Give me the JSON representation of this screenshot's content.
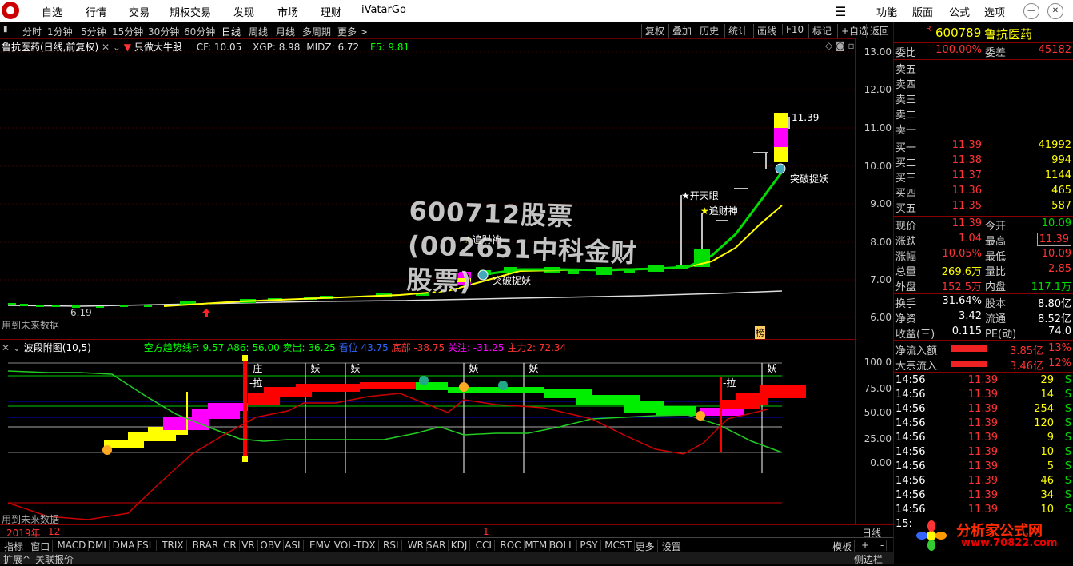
{
  "menu": {
    "items": [
      "自选",
      "行情",
      "交易",
      "期权交易",
      "发现",
      "市场",
      "理财",
      "iVatarGo"
    ],
    "right": [
      "功能",
      "版面",
      "公式",
      "选项"
    ]
  },
  "toolbar": {
    "periods": [
      "分时",
      "1分钟",
      "5分钟",
      "15分钟",
      "30分钟",
      "60分钟",
      "日线",
      "周线",
      "月线",
      "多周期",
      "更多 >"
    ],
    "active": "日线",
    "right": [
      "复权",
      "叠加",
      "历史",
      "统计",
      "画线",
      "F10",
      "标记",
      "+自选",
      "返回"
    ]
  },
  "main": {
    "title": "鲁抗医药(日线,前复权)",
    "indicator_name": "只做大牛股",
    "cf": "CF: 10.05",
    "xgp": "XGP: 8.98",
    "midz": "MIDZ: 6.72",
    "f5": "F5: 9.81",
    "yticks": [
      "13.00",
      "12.00",
      "11.00",
      "10.00",
      "9.00",
      "8.00",
      "7.00",
      "6.00"
    ],
    "annotations": {
      "high": "11.39",
      "low": "6.19",
      "tp1": "突破捉妖",
      "tp2": "突破捉妖",
      "zcs1": "追财神",
      "zcs2": "追财神",
      "ktg": "开天眼",
      "bang": "榜"
    },
    "note": "用到未来数据"
  },
  "sub": {
    "title": "波段附图(10,5)",
    "line": "空方趋势线F: 9.57  A86: 56.00  卖出: 36.25",
    "hold": "看位",
    "hold_val": "43.75",
    "bottom": "底部 -38.75",
    "focus": "关注: -31.25",
    "main": "主力2: 72.34",
    "yticks": [
      "100.0",
      "75.00",
      "50.00",
      "25.00",
      "0.00"
    ],
    "labels": {
      "zhuang": "庄",
      "la1": "拉",
      "la2": "拉",
      "yao": "妖"
    },
    "note": "用到未来数据"
  },
  "timeline": {
    "year": "2019年",
    "month": "12",
    "mark": "1",
    "period": "日线"
  },
  "bottom_tabs": [
    "指标",
    "窗口",
    "MACD",
    "DMI",
    "DMA",
    "FSL",
    "TRIX",
    "BRAR",
    "CR",
    "VR",
    "OBV",
    "ASI",
    "EMV",
    "VOL-TDX",
    "RSI",
    "WR",
    "SAR",
    "KDJ",
    "CCI",
    "ROC",
    "MTM",
    "BOLL",
    "PSY",
    "MCST",
    "更多",
    "设置"
  ],
  "bottom_right": "模板",
  "status": {
    "expand": "扩展^",
    "linked": "关联报价",
    "side": "侧边栏"
  },
  "quote": {
    "badge": "R",
    "code": "600789",
    "name": "鲁抗医药",
    "weibi_label": "委比",
    "weibi": "100.00%",
    "weicha_label": "委差",
    "weicha": "45182",
    "sells": [
      {
        "l": "卖五"
      },
      {
        "l": "卖四"
      },
      {
        "l": "卖三"
      },
      {
        "l": "卖二"
      },
      {
        "l": "卖一"
      }
    ],
    "buys": [
      {
        "l": "买一",
        "p": "11.39",
        "v": "41992"
      },
      {
        "l": "买二",
        "p": "11.38",
        "v": "994"
      },
      {
        "l": "买三",
        "p": "11.37",
        "v": "1144"
      },
      {
        "l": "买四",
        "p": "11.36",
        "v": "465"
      },
      {
        "l": "买五",
        "p": "11.35",
        "v": "587"
      }
    ],
    "stats": [
      {
        "l1": "现价",
        "v1": "11.39",
        "l2": "今开",
        "v2": "10.09"
      },
      {
        "l1": "涨跌",
        "v1": "1.04",
        "l2": "最高",
        "v2": "11.39"
      },
      {
        "l1": "涨幅",
        "v1": "10.05%",
        "l2": "最低",
        "v2": "10.09"
      },
      {
        "l1": "总量",
        "v1": "269.6万",
        "l2": "量比",
        "v2": "2.85"
      },
      {
        "l1": "外盘",
        "v1": "152.5万",
        "l2": "内盘",
        "v2": "117.1万"
      }
    ],
    "stats2": [
      {
        "l1": "换手",
        "v1": "31.64%",
        "l2": "股本",
        "v2": "8.80亿"
      },
      {
        "l1": "净资",
        "v1": "3.42",
        "l2": "流通",
        "v2": "8.52亿"
      },
      {
        "l1": "收益(三)",
        "v1": "0.115",
        "l2": "PE(动)",
        "v2": "74.0"
      }
    ],
    "flows": [
      {
        "l": "净流入额",
        "v": "3.85亿",
        "p": "13%"
      },
      {
        "l": "大宗流入",
        "v": "3.46亿",
        "p": "12%"
      }
    ],
    "ticks": [
      {
        "t": "14:56",
        "p": "11.39",
        "v": "29",
        "s": "S"
      },
      {
        "t": "14:56",
        "p": "11.39",
        "v": "14",
        "s": "S"
      },
      {
        "t": "14:56",
        "p": "11.39",
        "v": "254",
        "s": "S"
      },
      {
        "t": "14:56",
        "p": "11.39",
        "v": "120",
        "s": "S"
      },
      {
        "t": "14:56",
        "p": "11.39",
        "v": "9",
        "s": "S"
      },
      {
        "t": "14:56",
        "p": "11.39",
        "v": "10",
        "s": "S"
      },
      {
        "t": "14:56",
        "p": "11.39",
        "v": "5",
        "s": "S"
      },
      {
        "t": "14:56",
        "p": "11.39",
        "v": "46",
        "s": "S"
      },
      {
        "t": "14:56",
        "p": "11.39",
        "v": "34",
        "s": "S"
      },
      {
        "t": "14:56",
        "p": "11.39",
        "v": "10",
        "s": "S"
      },
      {
        "t": "15:",
        "p": "",
        "v": "",
        "s": ""
      }
    ]
  },
  "overlay": {
    "watermark": "600712股票(002651中科金财股票)",
    "site_name": "分析家公式网",
    "site_url": "www.70822.com"
  }
}
